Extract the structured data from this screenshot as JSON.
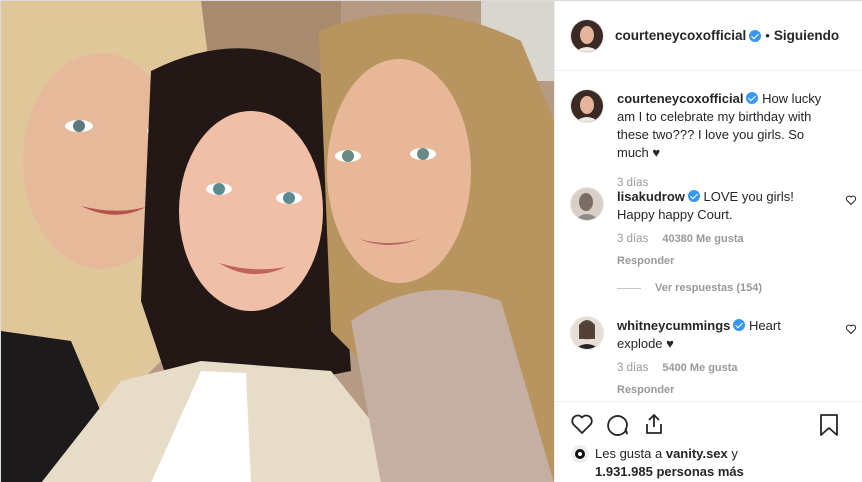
{
  "post": {
    "author": "courteneycoxofficial",
    "follow_status": "Siguiendo",
    "separator": "•"
  },
  "caption": {
    "username": "courteneycoxofficial",
    "text": "How lucky am I to celebrate my birthday with these two??? I love you girls. So much ♥",
    "time": "3 días"
  },
  "comments": [
    {
      "username": "lisakudrow",
      "text": "LOVE you girls! Happy happy Court.",
      "time": "3 días",
      "likes": "40380 Me gusta",
      "reply": "Responder"
    },
    {
      "username": "whitneycummings",
      "text": "Heart explode ♥",
      "time": "3 días",
      "likes": "5400 Me gusta",
      "reply": "Responder"
    }
  ],
  "view_replies": "Ver respuestas (154)",
  "likes_line": {
    "prefix": "Les gusta a",
    "user": "vanity.sex",
    "mid": "y",
    "count": "1.931.985 personas más"
  },
  "icons": [
    "heart-icon",
    "comment-icon",
    "share-icon",
    "bookmark-icon",
    "verified-icon"
  ],
  "colors": {
    "verified": "#3897f0",
    "muted": "#999999",
    "text": "#262626"
  }
}
